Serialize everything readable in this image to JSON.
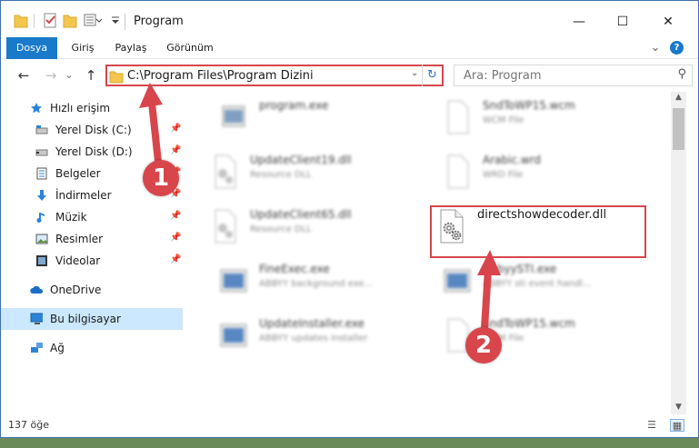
{
  "window": {
    "title": "Program",
    "controls": {
      "minimize": "—",
      "maximize": "☐",
      "close": "✕"
    }
  },
  "ribbon": {
    "tabs": [
      "Dosya",
      "Giriş",
      "Paylaş",
      "Görünüm"
    ],
    "collapse": "⌄",
    "help": "?"
  },
  "nav": {
    "back": "←",
    "forward": "→",
    "history": "⌄",
    "up": "↑",
    "address": "C:\\Program Files\\Program Dizini",
    "address_dropdown": "⌄",
    "refresh": "↻",
    "search_placeholder": "Ara: Program",
    "search_icon": "⚲"
  },
  "sidebar": {
    "items": [
      {
        "label": "Hızlı erişim",
        "icon": "star-icon",
        "pinned": false
      },
      {
        "label": "Yerel Disk (C:)",
        "icon": "drive-icon",
        "pinned": true
      },
      {
        "label": "Yerel Disk (D:)",
        "icon": "drive-icon",
        "pinned": true
      },
      {
        "label": "Belgeler",
        "icon": "documents-icon",
        "pinned": true
      },
      {
        "label": "İndirmeler",
        "icon": "downloads-icon",
        "pinned": true
      },
      {
        "label": "Müzik",
        "icon": "music-icon",
        "pinned": true
      },
      {
        "label": "Resimler",
        "icon": "pictures-icon",
        "pinned": true
      },
      {
        "label": "Videolar",
        "icon": "videos-icon",
        "pinned": true
      },
      {
        "label": "OneDrive",
        "icon": "cloud-icon",
        "pinned": false
      },
      {
        "label": "Bu bilgisayar",
        "icon": "computer-icon",
        "pinned": false
      },
      {
        "label": "Ağ",
        "icon": "network-icon",
        "pinned": false
      }
    ],
    "pin_glyph": "📌"
  },
  "files": [
    {
      "name": "program.exe",
      "desc": "",
      "type": "exe"
    },
    {
      "name": "SndToWP15.wcm",
      "desc": "WCM File",
      "type": "doc"
    },
    {
      "name": "UpdateClient19.dll",
      "desc": "Resource DLL",
      "type": "dll"
    },
    {
      "name": "Arabic.wrd",
      "desc": "WRD File",
      "type": "doc"
    },
    {
      "name": "UpdateClient65.dll",
      "desc": "Resource DLL",
      "type": "dll"
    },
    {
      "name": "directshowdecoder.dll",
      "desc": "",
      "type": "dll"
    },
    {
      "name": "FineExec.exe",
      "desc": "ABBYY background exe...",
      "type": "app"
    },
    {
      "name": "AbbyySTI.exe",
      "desc": "ABBYY sti event handl...",
      "type": "app"
    },
    {
      "name": "UpdateInstaller.exe",
      "desc": "ABBYY updates installer",
      "type": "app"
    },
    {
      "name": "SndToWP15.wcm",
      "desc": "WCM File",
      "type": "doc"
    }
  ],
  "annotations": {
    "step1": "1",
    "step2": "2",
    "color": "#d8464c"
  },
  "status": {
    "item_count": "137 öğe"
  },
  "colors": {
    "accent": "#1979ca",
    "selection": "#cce8ff",
    "highlight": "#d8464c"
  }
}
